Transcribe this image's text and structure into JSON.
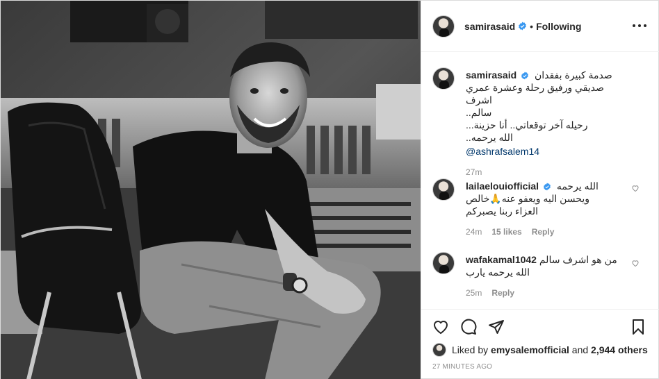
{
  "post": {
    "author": "samirasaid",
    "follow_status": "Following",
    "separator": "•",
    "caption_lines": [
      "صدمة كبيرة بفقدان",
      "صديقي ورفيق رحلة وعشرة عمري اشرف",
      "سالم..",
      "رحيله آخر توقعاتي.. أنا حزينة...",
      "الله يرحمه..",
      "@ashrafsalem14"
    ],
    "caption_time": "27m"
  },
  "comments": [
    {
      "user": "lailaelouiofficial",
      "lines": [
        "الله يرحمه",
        "ويحسن اليه ويعفو عنه🙏خالص",
        "العزاء ربنا يصبركم"
      ],
      "time": "24m",
      "likes": "15 likes",
      "reply": "Reply"
    },
    {
      "user": "wafakamal1042",
      "lines": [
        "من هو اشرف سالم",
        "الله يرحمه يارب"
      ],
      "time": "25m",
      "reply": "Reply"
    }
  ],
  "footer": {
    "liked_prefix": "Liked by",
    "liked_user": "emysalemofficial",
    "liked_and": "and",
    "liked_others": "2,944 others",
    "timestamp": "27 MINUTES AGO"
  },
  "icons": {
    "like": "heart-icon",
    "comment": "comment-icon",
    "share": "paper-plane-icon",
    "save": "bookmark-icon",
    "verified": "verified-badge-icon",
    "more": "more-options-icon"
  },
  "colors": {
    "text": "#262626",
    "muted": "#8e8e8e",
    "verified": "#3897f0",
    "mention": "#00376b"
  }
}
